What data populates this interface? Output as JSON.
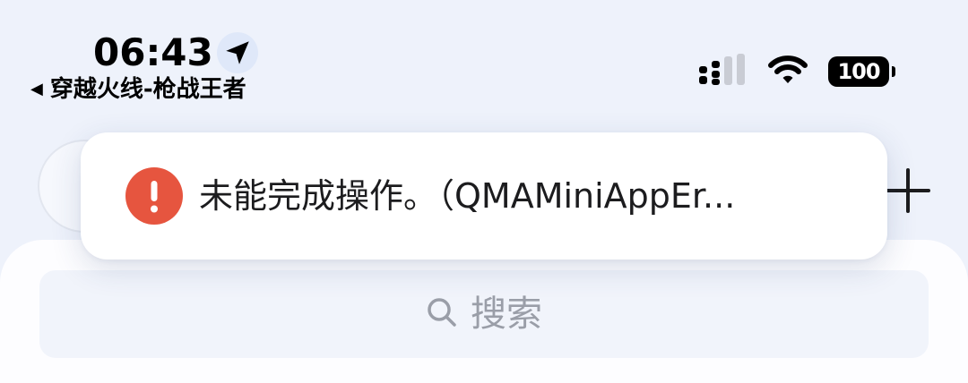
{
  "status_bar": {
    "time": "06:43",
    "location_icon": "location-arrow-icon",
    "back_arrow": "◀",
    "back_label": "穿越火线-枪战王者",
    "signal_icon": "cellular-signal-icon",
    "wifi_icon": "wifi-icon",
    "battery_level": "100"
  },
  "toast": {
    "icon": "error-icon",
    "message": "未能完成操作。（QMAMiniAppEr...",
    "icon_color": "#e6553f"
  },
  "header": {
    "plus_icon": "plus-icon"
  },
  "search": {
    "icon": "search-icon",
    "placeholder": "搜索"
  },
  "colors": {
    "background": "#eef2fb",
    "card": "#fdfdff",
    "search_bg": "#f1f4fb",
    "placeholder_text": "#9a9ea8",
    "error_red": "#e6553f"
  }
}
